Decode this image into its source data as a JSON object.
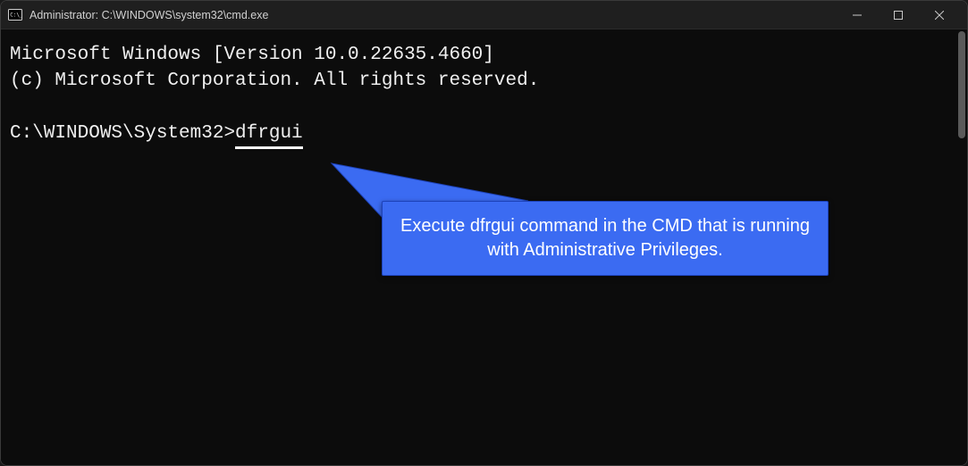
{
  "window": {
    "title": "Administrator: C:\\WINDOWS\\system32\\cmd.exe"
  },
  "terminal": {
    "line1": "Microsoft Windows [Version 10.0.22635.4660]",
    "line2": "(c) Microsoft Corporation. All rights reserved.",
    "prompt": "C:\\WINDOWS\\System32>",
    "command": "dfrgui"
  },
  "callout": {
    "text": "Execute dfrgui command in the CMD that is running with Administrative Privileges."
  },
  "colors": {
    "callout_bg": "#3b6bf2",
    "terminal_bg": "#0c0c0c",
    "titlebar_bg": "#1f1f1f"
  }
}
